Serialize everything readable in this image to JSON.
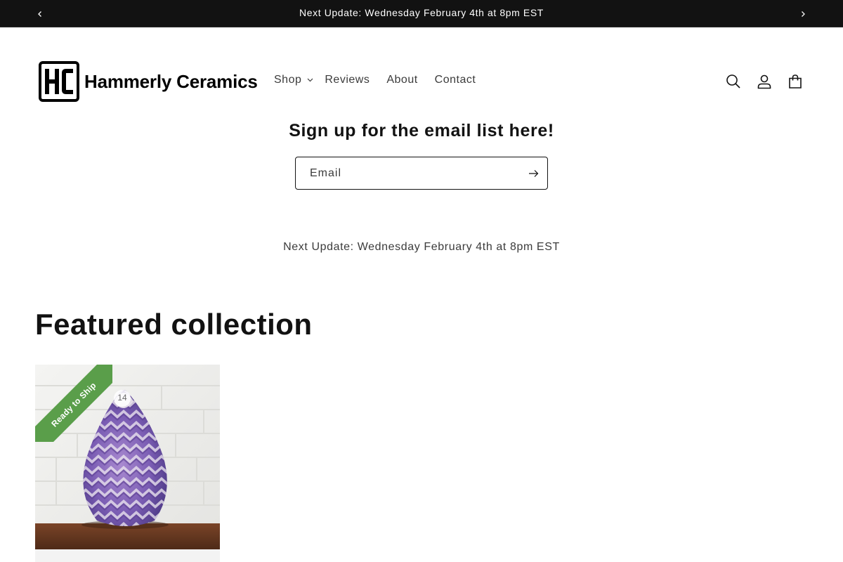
{
  "announcement": {
    "text": "Next Update: Wednesday February 4th at 8pm EST"
  },
  "header": {
    "logo_text": "Hammerly Ceramics",
    "nav": [
      {
        "label": "Shop"
      },
      {
        "label": "Reviews"
      },
      {
        "label": "About"
      },
      {
        "label": "Contact"
      }
    ],
    "icons": [
      "search-icon",
      "account-icon",
      "cart-icon"
    ]
  },
  "newsletter": {
    "title": "Sign up for the email list here!",
    "email_placeholder": "Email",
    "email_value": ""
  },
  "update_text": "Next Update: Wednesday February 4th at 8pm EST",
  "featured": {
    "title": "Featured collection",
    "product": {
      "badge": "Ready to Ship",
      "number_tag": "14"
    }
  },
  "colors": {
    "announcement_bg": "#121212",
    "badge_green": "#5a9e4a",
    "text": "#121212"
  }
}
